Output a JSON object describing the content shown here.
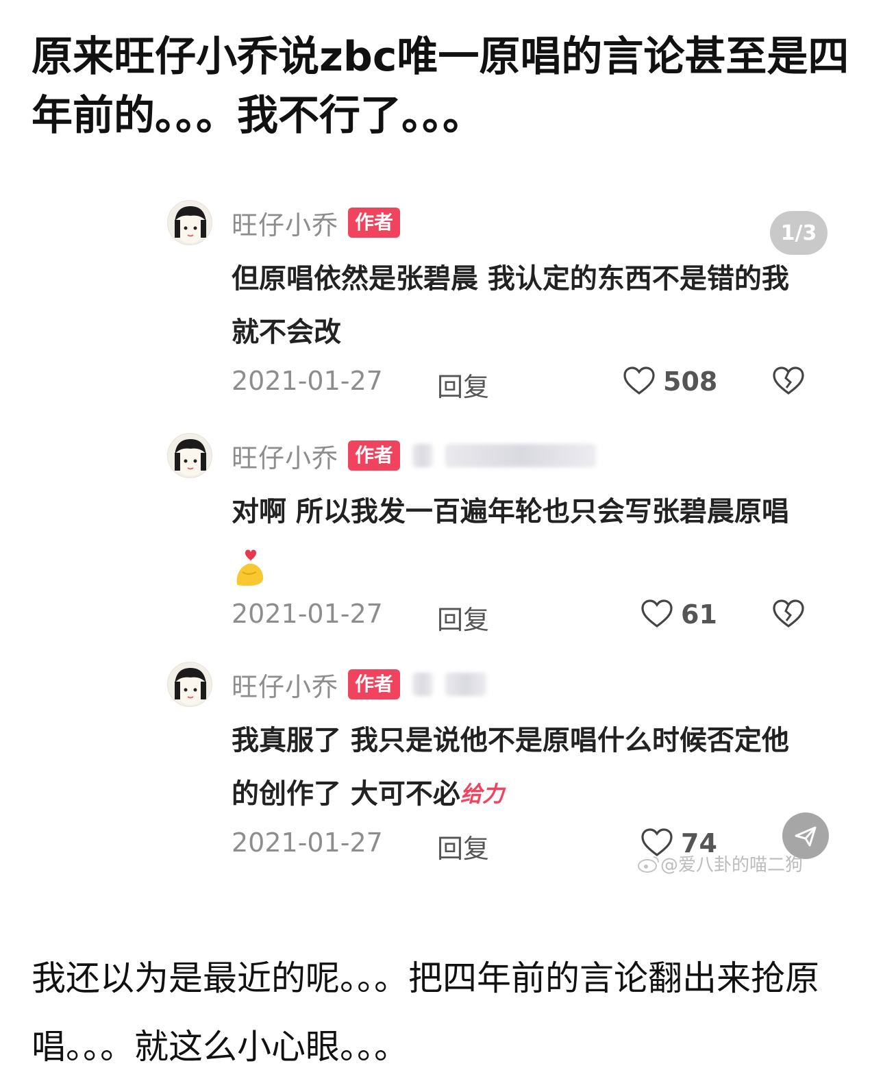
{
  "post": {
    "title": "原来旺仔小乔说zbc唯一原唱的言论甚至是四年前的。。。我不行了。。。",
    "footer": "我还以为是最近的呢。。。把四年前的言论翻出来抢原唱。。。就这么小心眼。。。"
  },
  "screenshot": {
    "page_indicator": "1/3",
    "author_badge": "作者",
    "reply_label": "回复",
    "watermark": "@爱八卦的喵二狗",
    "comments": [
      {
        "username": "旺仔小乔",
        "text": "但原唱依然是张碧晨 我认定的东西不是错的我就不会改",
        "date": "2021-01-27",
        "likes": "508"
      },
      {
        "username": "旺仔小乔",
        "text": "对啊 所以我发一百遍年轮也只会写张碧晨原唱",
        "date": "2021-01-27",
        "likes": "61"
      },
      {
        "username": "旺仔小乔",
        "text": "我真服了 我只是说他不是原唱什么时候否定他的创作了 大可不必",
        "sticker": "给力",
        "date": "2021-01-27",
        "likes": "74"
      }
    ]
  },
  "colors": {
    "badge": "#f0445e",
    "muted_text": "#8d8d8d",
    "pill_bg": "#c9c9c9"
  }
}
